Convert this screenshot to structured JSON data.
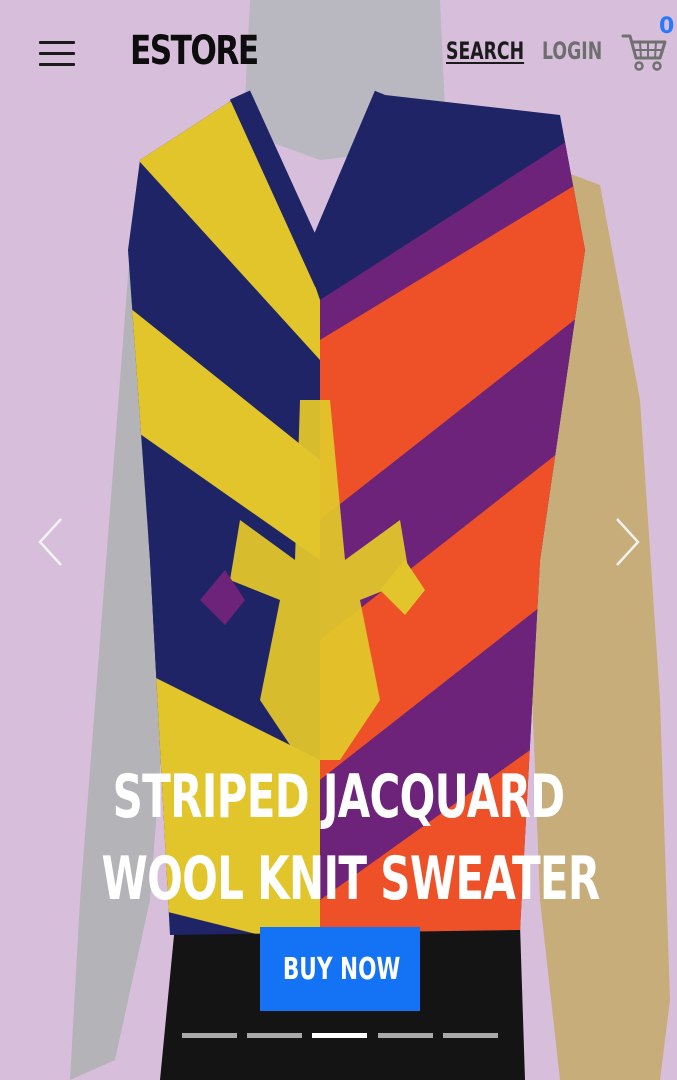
{
  "header": {
    "brand": "ESTORE",
    "nav": [
      {
        "label": "SEARCH"
      },
      {
        "label": "LOGIN"
      }
    ],
    "cart_count": "0"
  },
  "icons": {
    "menu": "hamburger-menu-icon",
    "cart": "shopping-cart-icon",
    "prev": "chevron-left-icon",
    "next": "chevron-right-icon"
  },
  "hero": {
    "title_lines": [
      "STRIPED JACQUARD",
      "WOOL KNIT SWEATER"
    ],
    "cta_label": "BUY NOW",
    "slide_count": 5,
    "active_slide": 3
  },
  "colors": {
    "background": "#d7bfdc",
    "accent": "#1472f5",
    "cart_count": "#2979ff",
    "indicator_active": "#ffffff",
    "indicator_inactive": "#a9a9a9"
  }
}
